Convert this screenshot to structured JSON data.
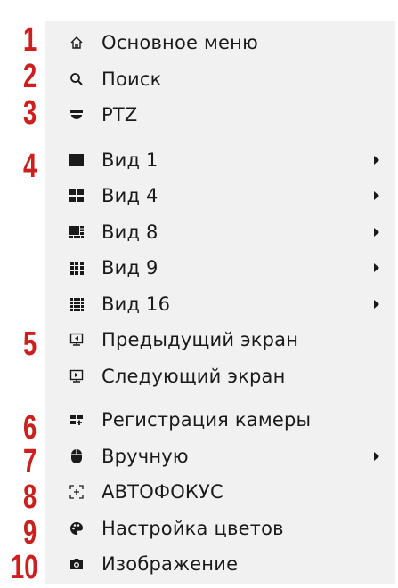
{
  "menu": {
    "items": [
      {
        "label": "Основное меню",
        "icon": "home-icon"
      },
      {
        "label": "Поиск",
        "icon": "search-icon"
      },
      {
        "label": "PTZ",
        "icon": "ptz-camera-icon"
      },
      {
        "label": "Вид 1",
        "icon": "view-1-icon",
        "submenu": true
      },
      {
        "label": "Вид 4",
        "icon": "view-4-icon",
        "submenu": true
      },
      {
        "label": "Вид 8",
        "icon": "view-8-icon",
        "submenu": true
      },
      {
        "label": "Вид 9",
        "icon": "view-9-icon",
        "submenu": true
      },
      {
        "label": "Вид 16",
        "icon": "view-16-icon",
        "submenu": true
      },
      {
        "label": "Предыдущий экран",
        "icon": "previous-screen-icon"
      },
      {
        "label": "Следующий экран",
        "icon": "next-screen-icon"
      },
      {
        "label": "Регистрация камеры",
        "icon": "camera-register-icon"
      },
      {
        "label": "Вручную",
        "icon": "mouse-icon",
        "submenu": true
      },
      {
        "label": "АВТОФОКУС",
        "icon": "autofocus-icon"
      },
      {
        "label": "Настройка цветов",
        "icon": "color-palette-icon"
      },
      {
        "label": "Изображение",
        "icon": "camera-icon"
      }
    ]
  },
  "callouts": [
    "1",
    "2",
    "3",
    "4",
    "5",
    "6",
    "7",
    "8",
    "9",
    "10"
  ],
  "colors": {
    "callout": "#cc1f1f",
    "menu_bg": "#f1f1f1",
    "text": "#1a1a1a"
  }
}
